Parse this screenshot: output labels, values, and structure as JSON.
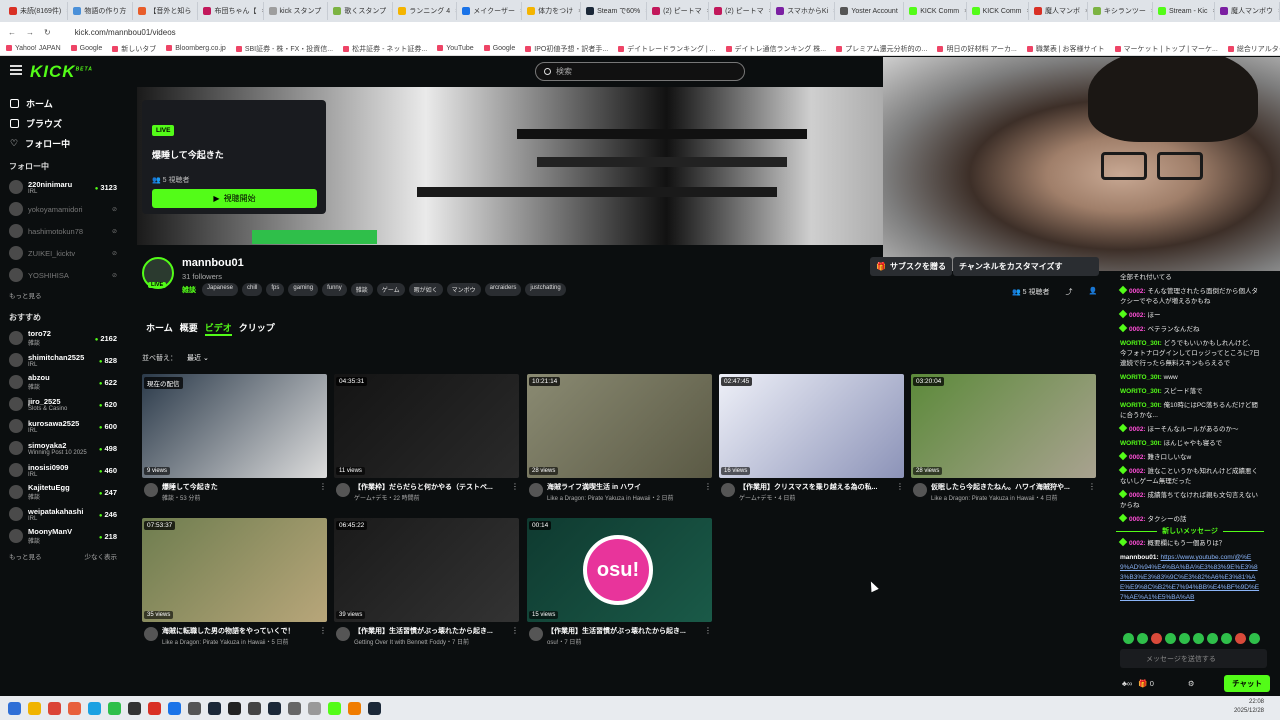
{
  "browser": {
    "tabs": [
      {
        "label": "未読(8169件)",
        "color": "#d93025"
      },
      {
        "label": "物語の作り方",
        "color": "#4a90d9"
      },
      {
        "label": "【音外と知ら",
        "color": "#e85d2a"
      },
      {
        "label": "布団ちゃん【",
        "color": "#c2185b"
      },
      {
        "label": "kick スタンプ",
        "color": "#9e9e9e"
      },
      {
        "label": "歌くスタンプ",
        "color": "#7cb342"
      },
      {
        "label": "ランニング 4",
        "color": "#f4b400"
      },
      {
        "label": "メイクーザー",
        "color": "#1a73e8"
      },
      {
        "label": "体力をつけ",
        "color": "#f4b400"
      },
      {
        "label": "Steam で60%",
        "color": "#1b2838"
      },
      {
        "label": "(2) ピートマ",
        "color": "#c2185b"
      },
      {
        "label": "(2) ピートマ",
        "color": "#c2185b"
      },
      {
        "label": "スマホからKi",
        "color": "#7b1fa2"
      },
      {
        "label": "Yoster Account",
        "color": "#555555"
      },
      {
        "label": "KICK Comm",
        "color": "#53fc18"
      },
      {
        "label": "KICK Comm",
        "color": "#53fc18"
      },
      {
        "label": "魔人マンボ",
        "color": "#d93025"
      },
      {
        "label": "キシランツー",
        "color": "#7cb342"
      },
      {
        "label": "Stream - Kic",
        "color": "#53fc18"
      },
      {
        "label": "魔人マンボウ",
        "color": "#7b1fa2"
      }
    ],
    "tab_close": "×",
    "address": "kick.com/mannbou01/videos",
    "bookmarks": [
      "Yahoo! JAPAN",
      "Google",
      "新しいタブ",
      "Bloomberg.co.jp",
      "SBI証券 - 株・FX・投資信...",
      "松井証券 - ネット証券...",
      "YouTube",
      "Google",
      "IPO初値予想・訳者手...",
      "デイトレードランキング | ...",
      "デイトレ通信ランキング 株...",
      "プレミアム還元分析的の...",
      "明日の好材料 アーカ...",
      "職業表 | お客様サイト",
      "マーケット | トップ | マーケ...",
      "総合リアルタイムランキン...",
      "Kick"
    ]
  },
  "topnav": {
    "logo": "KICK",
    "logo_beta": "BETA",
    "search_placeholder": "検索"
  },
  "sidebar": {
    "nav": [
      {
        "label": "ホーム"
      },
      {
        "label": "ブラウズ"
      },
      {
        "label": "フォロー中"
      }
    ],
    "following_title": "フォロー中",
    "following": [
      {
        "name": "220ninimaru",
        "category": "IRL",
        "viewers": "3123",
        "live": true
      },
      {
        "name": "yokoyamamidori",
        "category": "",
        "viewers": "",
        "live": false
      },
      {
        "name": "hashimotokun78",
        "category": "",
        "viewers": "",
        "live": false
      },
      {
        "name": "ZUIKEI_kicktv",
        "category": "",
        "viewers": "",
        "live": false
      },
      {
        "name": "YOSHIHISA",
        "category": "",
        "viewers": "",
        "live": false
      }
    ],
    "show_more": "もっと見る",
    "recommended_title": "おすすめ",
    "recommended": [
      {
        "name": "toro72",
        "category": "雑談",
        "viewers": "2162"
      },
      {
        "name": "shimitchan2525",
        "category": "IRL",
        "viewers": "828"
      },
      {
        "name": "abzou",
        "category": "雑談",
        "viewers": "622"
      },
      {
        "name": "jiro_2525",
        "category": "Slots & Casino",
        "viewers": "620"
      },
      {
        "name": "kurosawa2525",
        "category": "IRL",
        "viewers": "600"
      },
      {
        "name": "simoyaka2",
        "category": "Winning Post 10 2025",
        "viewers": "498"
      },
      {
        "name": "inosisi0909",
        "category": "IRL",
        "viewers": "460"
      },
      {
        "name": "KajitetuEgg",
        "category": "雑談",
        "viewers": "247"
      },
      {
        "name": "weipatakahashi",
        "category": "IRL",
        "viewers": "246"
      },
      {
        "name": "MoonyManV",
        "category": "雑談",
        "viewers": "218"
      }
    ],
    "show_more2": "もっと見る",
    "show_less": "少なく表示"
  },
  "popup": {
    "badge": "LIVE",
    "title": "爆睡して今起きた",
    "viewers": "5 視聴者",
    "watch_label": "視聴開始"
  },
  "channel": {
    "name": "mannbou01",
    "followers": "31 followers",
    "live_badge": "LIVE",
    "category": "雑談",
    "tags": [
      "Japanese",
      "chill",
      "fps",
      "gaming",
      "funny",
      "雑談",
      "ゲーム",
      "暇が如く",
      "マンボウ",
      "arcraiders",
      "justchatting"
    ],
    "subscribe_label": "サブスクを贈る",
    "customize_label": "チャンネルをカスタマイズす",
    "viewers": "5 視聴者"
  },
  "content_tabs": [
    {
      "label": "ホーム"
    },
    {
      "label": "概要"
    },
    {
      "label": "ビデオ",
      "active": true
    },
    {
      "label": "クリップ"
    }
  ],
  "sort": {
    "label": "並べ替え：",
    "value": "最近"
  },
  "videos": [
    {
      "duration": "現在の配信",
      "views": "9 views",
      "title": "爆睡して今起きた",
      "sub": "雑談・53 分前",
      "colors": [
        "#2b3a4a",
        "#ddd"
      ]
    },
    {
      "duration": "04:35:31",
      "views": "11 views",
      "title": "【作業枠】だらだらと何かやる（テストペ...",
      "sub": "ゲーム+デモ・22 時間前",
      "colors": [
        "#141414",
        "#2a2a2a"
      ]
    },
    {
      "duration": "10:21:14",
      "views": "28 views",
      "title": "海賊ライフ満喫生活 in ハワイ",
      "sub": "Like a Dragon: Pirate Yakuza in Hawaii・2 日前",
      "colors": [
        "#8a8a72",
        "#5b5a45"
      ]
    },
    {
      "duration": "02:47:45",
      "views": "16 views",
      "title": "【作業用】クリスマスを乗り越える為の私...",
      "sub": "ゲーム+デモ・4 日前",
      "colors": [
        "#eef0f8",
        "#8c93b8"
      ]
    },
    {
      "duration": "03:20:04",
      "views": "28 views",
      "title": "仮眠したら今起きたねん。ハワイ海賊狩や...",
      "sub": "Like a Dragon: Pirate Yakuza in Hawaii・4 日前",
      "colors": [
        "#5c8a3a",
        "#a9a290"
      ]
    },
    {
      "duration": "07:53:37",
      "views": "35 views",
      "title": "海賊に転職した男の物語をやっていくで！",
      "sub": "Like a Dragon: Pirate Yakuza in Hawaii・5 日前",
      "colors": [
        "#6e7d4f",
        "#b8a67a"
      ]
    },
    {
      "duration": "06:45:22",
      "views": "39 views",
      "title": "【作業用】生活習慣がぶっ壊れたから起き...",
      "sub": "Getting Over It with Bennett Foddy・7 日前",
      "colors": [
        "#1a1a1a",
        "#333"
      ]
    },
    {
      "duration": "00:14",
      "views": "15 views",
      "title": "【作業用】生活習慣がぶっ壊れたから起き...",
      "sub": "osu!・7 日前",
      "colors": [
        "#0f3a30",
        "#1a5a48"
      ]
    }
  ],
  "osu_logo": "osu!",
  "chat": {
    "messages": [
      {
        "user": "",
        "text": "全部それ付いてる",
        "color": "#e8e8e8"
      },
      {
        "user": "0002:",
        "text": "そんな管理されたら面倒だから個人タクシーでやる人が増えるかもね",
        "color": "#ff4fd8",
        "badge": true
      },
      {
        "user": "0002:",
        "text": "ほー",
        "color": "#ff4fd8",
        "badge": true
      },
      {
        "user": "0002:",
        "text": "ベテランなんだね",
        "color": "#ff4fd8",
        "badge": true
      },
      {
        "user": "WORITO_30t:",
        "text": "どうでもいいかもしれんけど、今フォトナログインしてロッジってところに7日連続で行ったら無料スキンもらえるで",
        "color": "#53fc18"
      },
      {
        "user": "WORITO_30t:",
        "text": "www",
        "color": "#53fc18"
      },
      {
        "user": "WORITO_30t:",
        "text": "スピード落で",
        "color": "#53fc18"
      },
      {
        "user": "WORITO_30t:",
        "text": "俺10時にはPC落ちるんだけど間に合うかな...",
        "color": "#53fc18"
      },
      {
        "user": "0002:",
        "text": "ほーそんなルールがあるのか〜",
        "color": "#ff4fd8",
        "badge": true
      },
      {
        "user": "WORITO_30t:",
        "text": "ほんじゃやも寝るで",
        "color": "#53fc18"
      },
      {
        "user": "0002:",
        "text": "難き口しいなw",
        "color": "#ff4fd8",
        "badge": true
      },
      {
        "user": "0002:",
        "text": "誰なこというかも知れんけど成績悪くないしゲーム無理だった",
        "color": "#ff4fd8",
        "badge": true
      },
      {
        "user": "0002:",
        "text": "成績落ちてなければ親も文句言えないからね",
        "color": "#ff4fd8",
        "badge": true
      },
      {
        "user": "0002:",
        "text": "タクシーの話",
        "color": "#ff4fd8",
        "badge": true
      }
    ],
    "new_messages": "新しいメッセージ",
    "after": [
      {
        "user": "0002:",
        "text": "概要欄にもう一個ありは？",
        "color": "#ff4fd8",
        "badge": true
      },
      {
        "user": "mannbou01:",
        "text": "https://www.youtube.com/@%E9%AD%94%E4%BA%BA%E3%83%9E%E3%83%B3%E3%83%9C%E3%82%A6%E3%81%AE%E9%8C%B2%E7%94%BB%E4%BF%9D%E7%AE%A1%E5%BA%AB",
        "color": "#ffffff",
        "link": true
      }
    ],
    "input_placeholder": "メッセージを送信する",
    "footer_count_a": "∞",
    "footer_count_b": "0",
    "send_label": "チャット"
  },
  "taskbar": {
    "time": "22:08",
    "date": "2025/12/28"
  }
}
